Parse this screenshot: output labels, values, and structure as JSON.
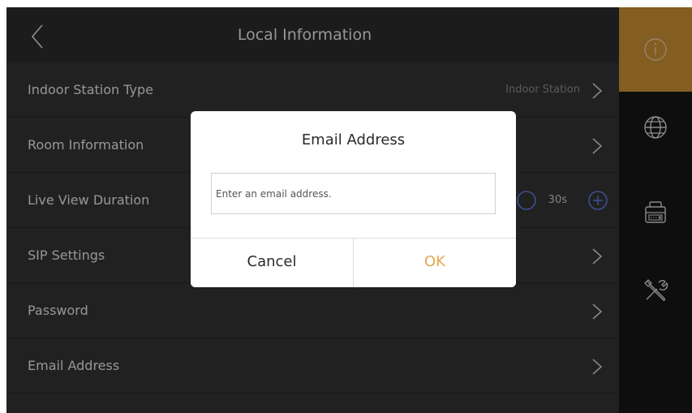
{
  "header": {
    "title": "Local Information"
  },
  "rows": [
    {
      "label": "Indoor Station Type",
      "value": "Indoor Station"
    },
    {
      "label": "Room Information",
      "value": ""
    },
    {
      "label": "Live View Duration",
      "value": "30s"
    },
    {
      "label": "SIP Settings",
      "value": ""
    },
    {
      "label": "Password",
      "value": ""
    },
    {
      "label": "Email Address",
      "value": ""
    }
  ],
  "sidebar": {
    "items": [
      {
        "icon": "info-icon",
        "active": true
      },
      {
        "icon": "globe-icon",
        "active": false
      },
      {
        "icon": "device-icon",
        "active": false
      },
      {
        "icon": "tools-icon",
        "active": false
      }
    ]
  },
  "dialog": {
    "title": "Email Address",
    "input_value": "",
    "input_placeholder": "Enter an email address.",
    "cancel_label": "Cancel",
    "ok_label": "OK"
  },
  "colors": {
    "accent": "#c98f33",
    "ok_text": "#e2a84e",
    "panel": "#343434",
    "sidebar": "#161616"
  }
}
